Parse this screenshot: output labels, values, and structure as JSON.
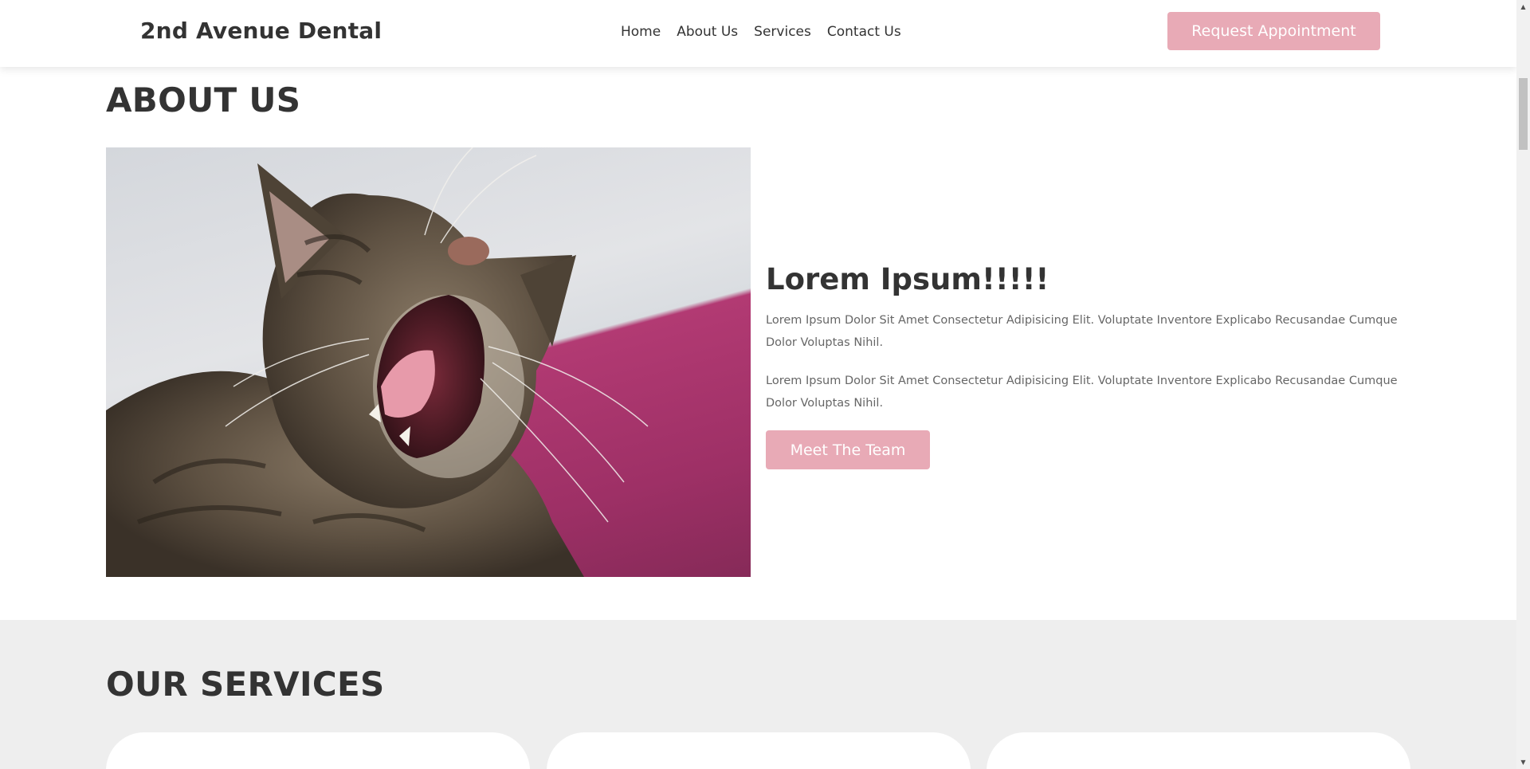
{
  "header": {
    "logo": "2nd Avenue Dental",
    "nav": [
      "Home",
      "About Us",
      "Services",
      "Contact Us"
    ],
    "cta_label": "Request Appointment"
  },
  "about": {
    "title": "ABOUT US",
    "heading": "Lorem Ipsum!!!!!",
    "paragraphs": [
      "Lorem Ipsum Dolor Sit Amet Consectetur Adipisicing Elit. Voluptate Inventore Explicabo Recusandae Cumque Dolor Voluptas Nihil.",
      "Lorem Ipsum Dolor Sit Amet Consectetur Adipisicing Elit. Voluptate Inventore Explicabo Recusandae Cumque Dolor Voluptas Nihil."
    ],
    "button_label": "Meet The Team",
    "image_icon": "yawning-cat-photo"
  },
  "services": {
    "title": "OUR SERVICES"
  },
  "colors": {
    "accent": "#e8aab6",
    "text": "#333333",
    "muted_text": "#666666",
    "services_bg": "#eeeeee"
  }
}
